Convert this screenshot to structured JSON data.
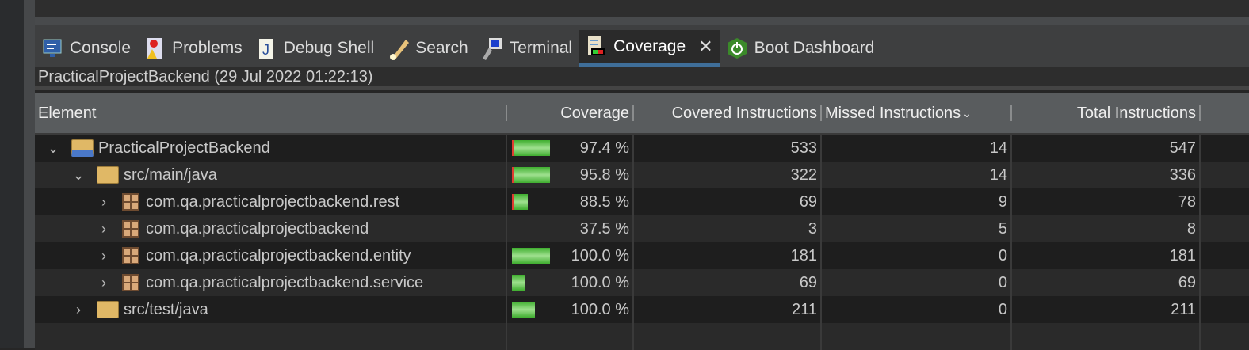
{
  "tabs": [
    {
      "label": "Console",
      "icon": "console-icon"
    },
    {
      "label": "Problems",
      "icon": "problems-icon"
    },
    {
      "label": "Debug Shell",
      "icon": "debug-shell-icon"
    },
    {
      "label": "Search",
      "icon": "search-icon"
    },
    {
      "label": "Terminal",
      "icon": "terminal-icon"
    },
    {
      "label": "Coverage",
      "icon": "coverage-icon",
      "active": true
    },
    {
      "label": "Boot Dashboard",
      "icon": "boot-dashboard-icon"
    }
  ],
  "session": "PracticalProjectBackend (29 Jul 2022 01:22:13)",
  "columns": [
    "Element",
    "Coverage",
    "Covered Instructions",
    "Missed Instructions",
    "Total Instructions"
  ],
  "rows": [
    {
      "name": "PracticalProjectBackend",
      "type": "project",
      "level": 0,
      "toggle": "⌄",
      "coverage": "97.4 %",
      "covered": "533",
      "missed": "14",
      "total": "547",
      "bar_fraction": 1.0,
      "missed_fraction": 0.026
    },
    {
      "name": "src/main/java",
      "type": "folder",
      "level": 1,
      "toggle": "⌄",
      "coverage": "95.8 %",
      "covered": "322",
      "missed": "14",
      "total": "336",
      "bar_fraction": 1.0,
      "missed_fraction": 0.042
    },
    {
      "name": "com.qa.practicalprojectbackend.rest",
      "type": "package",
      "level": 2,
      "toggle": "›",
      "coverage": "88.5 %",
      "covered": "69",
      "missed": "9",
      "total": "78",
      "bar_fraction": 0.41,
      "missed_fraction": 0.115
    },
    {
      "name": "com.qa.practicalprojectbackend",
      "type": "package",
      "level": 2,
      "toggle": "›",
      "coverage": "37.5 %",
      "covered": "3",
      "missed": "5",
      "total": "8",
      "bar_fraction": 0.0,
      "missed_fraction": 0.625
    },
    {
      "name": "com.qa.practicalprojectbackend.entity",
      "type": "package",
      "level": 2,
      "toggle": "›",
      "coverage": "100.0 %",
      "covered": "181",
      "missed": "0",
      "total": "181",
      "bar_fraction": 1.0,
      "missed_fraction": 0
    },
    {
      "name": "com.qa.practicalprojectbackend.service",
      "type": "package",
      "level": 2,
      "toggle": "›",
      "coverage": "100.0 %",
      "covered": "69",
      "missed": "0",
      "total": "69",
      "bar_fraction": 0.36,
      "missed_fraction": 0
    },
    {
      "name": "src/test/java",
      "type": "folder",
      "level": 1,
      "toggle": "›",
      "coverage": "100.0 %",
      "covered": "211",
      "missed": "0",
      "total": "211",
      "bar_fraction": 0.6,
      "missed_fraction": 0
    }
  ]
}
